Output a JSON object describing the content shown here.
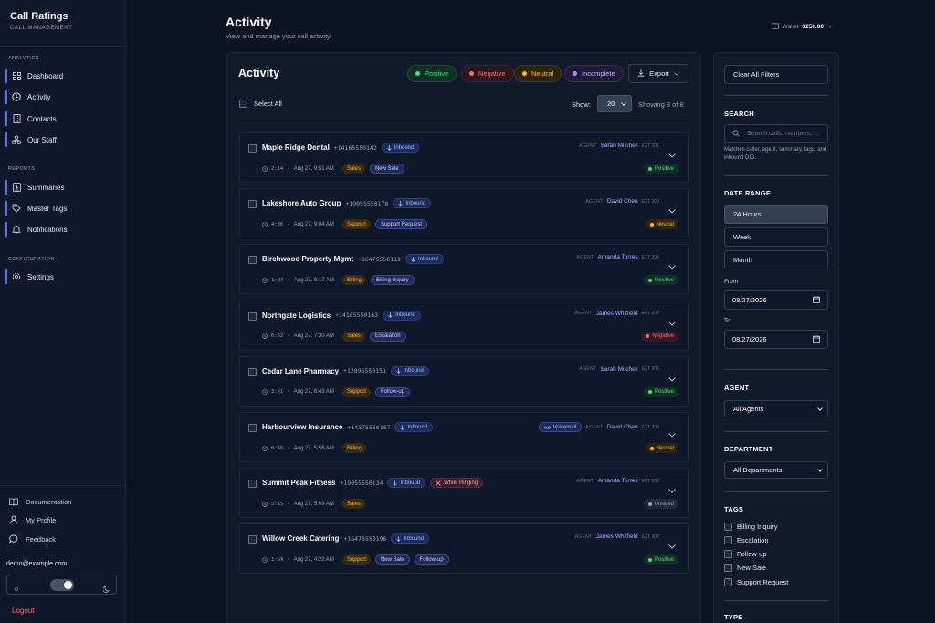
{
  "sidebar": {
    "brand_title": "Call Ratings",
    "brand_subtitle": "CALL MANAGEMENT",
    "sections": {
      "analytics": "ANALYTICS",
      "reports": "REPORTS",
      "configuration": "CONFIGURATION"
    },
    "items": {
      "dashboard": "Dashboard",
      "activity": "Activity",
      "contacts": "Contacts",
      "our_staff": "Our Staff",
      "summaries": "Summaries",
      "master_tags": "Master Tags",
      "notifications": "Notifications",
      "settings": "Settings"
    },
    "bottom": {
      "documentation": "Documentation",
      "my_profile": "My Profile",
      "feedback": "Feedback"
    },
    "email": "demo@example.com",
    "logout": "Logout"
  },
  "header": {
    "title": "Activity",
    "subtitle": "View and manage your call activity.",
    "wallet_label": "Wallet",
    "wallet_amount": "$250.00"
  },
  "panel": {
    "title": "Activity",
    "chips": {
      "positive": "Positive",
      "negative": "Negative",
      "neutral": "Neutral",
      "incomplete": "Incomplete"
    },
    "export_label": "Export",
    "select_all": "Select All",
    "show_label": "Show:",
    "page_size": "20",
    "showing_text": "Showing 8 of 8",
    "agent_label": "AGENT"
  },
  "calls": [
    {
      "name": "Maple Ridge Dental",
      "number": "+14165550142",
      "direction": "Inbound",
      "agent": "Sarah Mitchell",
      "ext": "EXT 201",
      "duration": "2:14",
      "date": "Aug 27, 9:51 AM",
      "category": "Sales",
      "tags": [
        "New Sale"
      ],
      "status": "Positive"
    },
    {
      "name": "Lakeshore Auto Group",
      "number": "+19055550178",
      "direction": "Inbound",
      "agent": "David Chen",
      "ext": "EXT 203",
      "duration": "4:36",
      "date": "Aug 27, 9:04 AM",
      "category": "Support",
      "tags": [
        "Support Request"
      ],
      "status": "Neutral"
    },
    {
      "name": "Birchwood Property Mgmt",
      "number": "+16475550119",
      "direction": "Inbound",
      "agent": "Amanda Torres",
      "ext": "EXT 205",
      "duration": "1:07",
      "date": "Aug 27, 8:17 AM",
      "category": "Billing",
      "tags": [
        "Billing Inquiry"
      ],
      "status": "Positive"
    },
    {
      "name": "Northgate Logistics",
      "number": "+14165550163",
      "direction": "Inbound",
      "agent": "James Whitfield",
      "ext": "EXT 207",
      "duration": "6:52",
      "date": "Aug 27, 7:30 AM",
      "category": "Sales",
      "tags": [
        "Escalation"
      ],
      "status": "Negative"
    },
    {
      "name": "Cedar Lane Pharmacy",
      "number": "+12895550151",
      "direction": "Inbound",
      "agent": "Sarah Mitchell",
      "ext": "EXT 201",
      "duration": "3:21",
      "date": "Aug 27, 6:43 AM",
      "category": "Support",
      "tags": [
        "Follow-up"
      ],
      "status": "Positive"
    },
    {
      "name": "Harbourview Insurance",
      "number": "+14375550187",
      "direction": "Inbound",
      "voicemail": "Voicemail",
      "agent": "David Chen",
      "ext": "EXT 203",
      "duration": "0:46",
      "date": "Aug 27, 5:56 AM",
      "category": "Billing",
      "tags": [],
      "status": "Neutral"
    },
    {
      "name": "Summit Peak Fitness",
      "number": "+19055550134",
      "direction": "Inbound",
      "ringing": "While Ringing",
      "agent": "Amanda Torres",
      "ext": "EXT 205",
      "duration": "5:15",
      "date": "Aug 27, 5:09 AM",
      "category": "Sales",
      "tags": [],
      "status": "Unrated"
    },
    {
      "name": "Willow Creek Catering",
      "number": "+16475550196",
      "direction": "Inbound",
      "agent": "James Whitfield",
      "ext": "EXT 207",
      "duration": "1:59",
      "date": "Aug 27, 4:22 AM",
      "category": "Support",
      "tags": [
        "New Sale",
        "Follow-up"
      ],
      "status": "Positive"
    }
  ],
  "filters": {
    "clear_all": "Clear All Filters",
    "search_heading": "SEARCH",
    "search_placeholder": "Search calls, numbers, ...",
    "search_help": "Matches caller, agent, summary, tags, and inbound DID.",
    "date_heading": "DATE RANGE",
    "range_24h": "24 Hours",
    "range_week": "Week",
    "range_month": "Month",
    "from_label": "From",
    "from_value": "08/27/2026",
    "to_label": "To",
    "to_value": "08/27/2026",
    "agent_heading": "AGENT",
    "agent_value": "All Agents",
    "department_heading": "DEPARTMENT",
    "department_value": "All Departments",
    "tags_heading": "TAGS",
    "tags": [
      "Billing Inquiry",
      "Escalation",
      "Follow-up",
      "New Sale",
      "Support Request"
    ],
    "type_heading": "TYPE"
  },
  "colors": {
    "accent": "#5b6cf0",
    "positive": "#4ade80",
    "negative": "#f87171",
    "neutral": "#fbbf24",
    "incomplete": "#a78bfa"
  }
}
